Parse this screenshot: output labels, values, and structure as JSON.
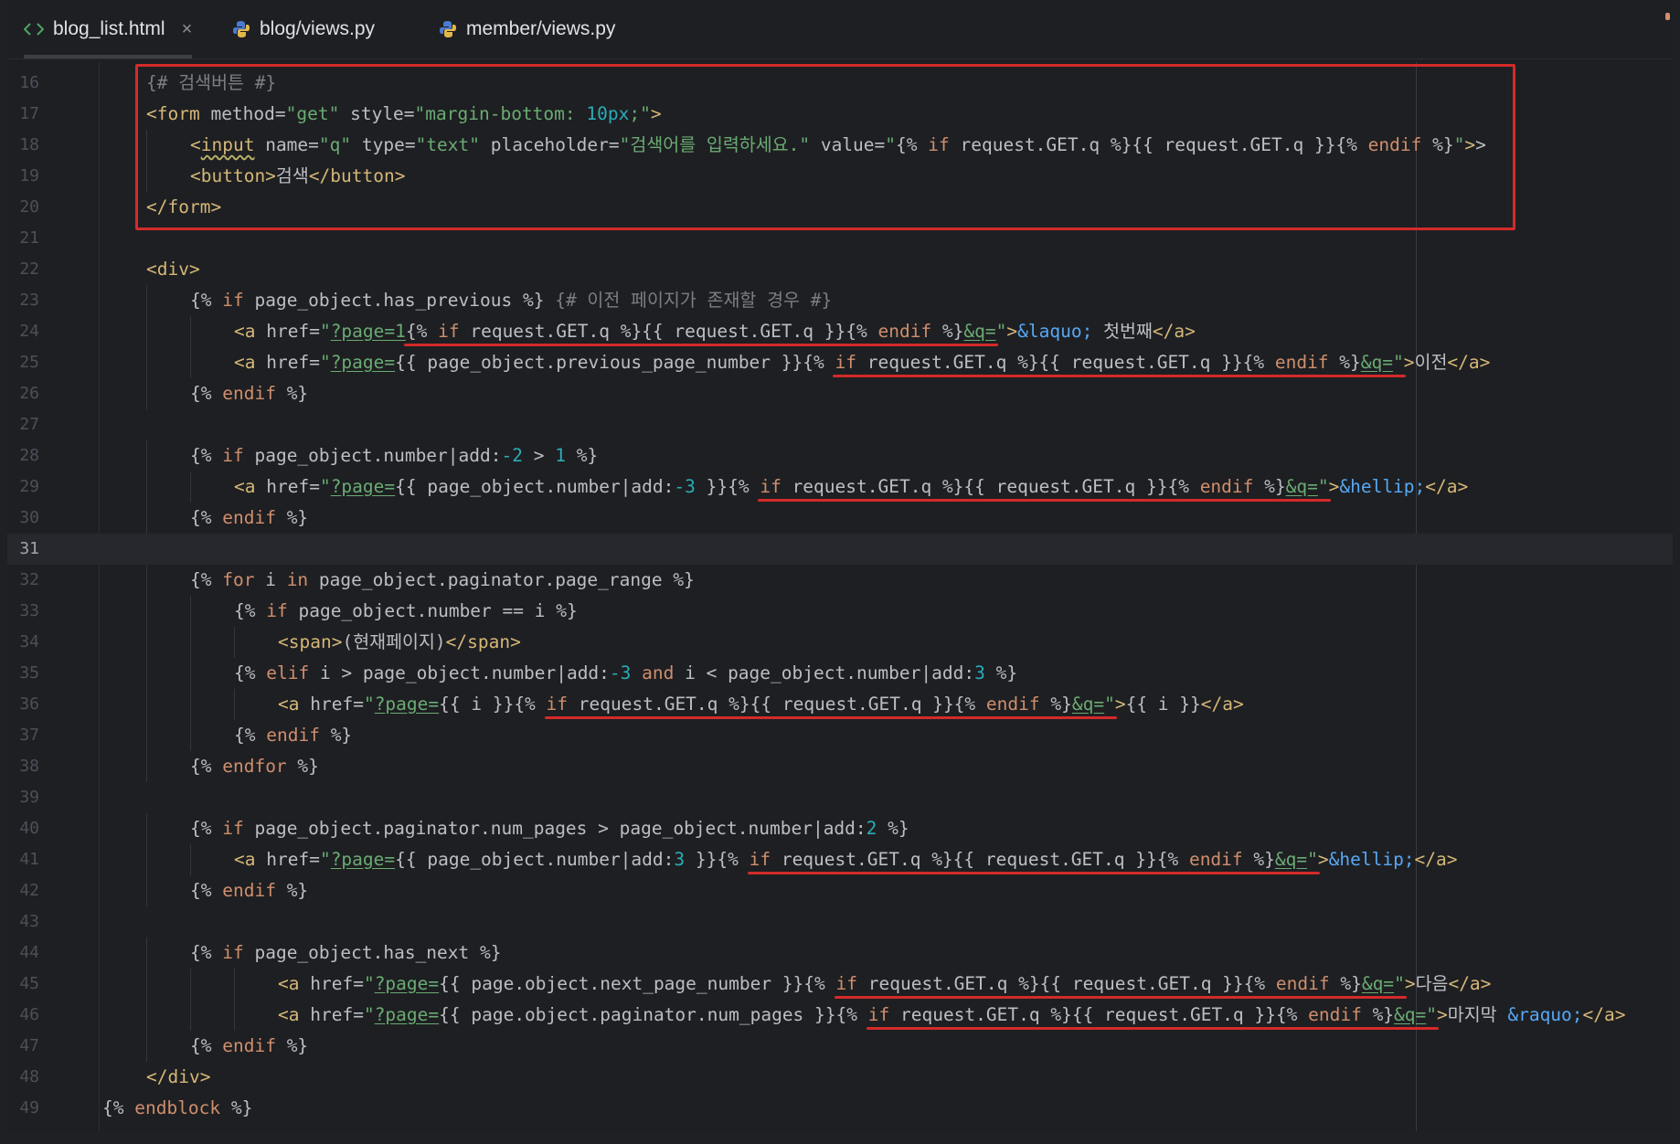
{
  "tabs": [
    {
      "label": "blog_list.html",
      "icon": "html-file-icon",
      "active": true,
      "close": "×"
    },
    {
      "label": "blog/views.py",
      "icon": "python-file-icon",
      "active": false
    },
    {
      "label": "member/views.py",
      "icon": "python-file-icon",
      "active": false
    }
  ],
  "current_line": 31,
  "colors": {
    "annotation_red": "#d42a2a",
    "keyword": "#cf8e6d",
    "string": "#6aab73",
    "tag": "#d5b778",
    "number": "#2aacb8",
    "entity": "#56a8f5"
  },
  "lines": [
    {
      "n": 16,
      "indent": 1,
      "tokens": [
        [
          "cm",
          "{# 검색버튼 #}"
        ]
      ]
    },
    {
      "n": 17,
      "indent": 1,
      "tokens": [
        [
          "tag",
          "<form "
        ],
        [
          "attr",
          "method="
        ],
        [
          "str",
          "\"get\" "
        ],
        [
          "attr",
          "style="
        ],
        [
          "str",
          "\"margin-bottom: "
        ],
        [
          "num",
          "10px"
        ],
        [
          "str",
          ";\""
        ],
        [
          "tag",
          ">"
        ]
      ]
    },
    {
      "n": 18,
      "indent": 2,
      "tokens": [
        [
          "tag",
          "<"
        ],
        [
          "tagsq",
          "input"
        ],
        [
          "tag",
          " "
        ],
        [
          "attr",
          "name="
        ],
        [
          "str",
          "\"q\" "
        ],
        [
          "attr",
          "type="
        ],
        [
          "str",
          "\"text\" "
        ],
        [
          "attr",
          "placeholder="
        ],
        [
          "str",
          "\"검색어를 입력하세요.\" "
        ],
        [
          "attr",
          "value="
        ],
        [
          "str",
          "\""
        ],
        [
          "tpl",
          "{% "
        ],
        [
          "kw",
          "if "
        ],
        [
          "tpl",
          "request.GET.q %}{{ request.GET.q }}{% "
        ],
        [
          "kw",
          "endif "
        ],
        [
          "tpl",
          "%}"
        ],
        [
          "str",
          "\""
        ],
        [
          "tag",
          ">"
        ],
        [
          "txt",
          ">"
        ]
      ]
    },
    {
      "n": 19,
      "indent": 2,
      "tokens": [
        [
          "tag",
          "<button>"
        ],
        [
          "txt",
          "검색"
        ],
        [
          "tag",
          "</button>"
        ]
      ]
    },
    {
      "n": 20,
      "indent": 1,
      "tokens": [
        [
          "tag",
          "</form>"
        ]
      ]
    },
    {
      "n": 21,
      "indent": 0,
      "tokens": []
    },
    {
      "n": 22,
      "indent": 1,
      "tokens": [
        [
          "tag",
          "<div>"
        ]
      ]
    },
    {
      "n": 23,
      "indent": 2,
      "tokens": [
        [
          "tpl",
          "{% "
        ],
        [
          "kw",
          "if "
        ],
        [
          "tpl",
          "page_object.has_previous %} "
        ],
        [
          "cm",
          "{# 이전 페이지가 존재할 경우 #}"
        ]
      ]
    },
    {
      "n": 24,
      "indent": 3,
      "tokens": [
        [
          "tag",
          "<a "
        ],
        [
          "attr",
          "href="
        ],
        [
          "str",
          "\""
        ],
        [
          "strul",
          "?page=1"
        ],
        [
          "tpl",
          "{% "
        ],
        [
          "kw",
          "if "
        ],
        [
          "tpl",
          "request.GET.q %}{{ request.GET.q }}{% "
        ],
        [
          "kw",
          "endif "
        ],
        [
          "tpl",
          "%}"
        ],
        [
          "strul",
          "&q="
        ],
        [
          "str",
          "\""
        ],
        [
          "tag",
          ">"
        ],
        [
          "ent",
          "&laquo;"
        ],
        [
          "txt",
          " 첫번째"
        ],
        [
          "tag",
          "</a>"
        ]
      ]
    },
    {
      "n": 25,
      "indent": 3,
      "tokens": [
        [
          "tag",
          "<a "
        ],
        [
          "attr",
          "href="
        ],
        [
          "str",
          "\""
        ],
        [
          "strul",
          "?page="
        ],
        [
          "tpl",
          "{{ page_object.previous_page_number }}{% "
        ],
        [
          "kw",
          "if "
        ],
        [
          "tpl",
          "request.GET.q %}{{ request.GET.q }}{% "
        ],
        [
          "kw",
          "endif "
        ],
        [
          "tpl",
          "%}"
        ],
        [
          "strul",
          "&q="
        ],
        [
          "str",
          "\""
        ],
        [
          "tag",
          ">"
        ],
        [
          "txt",
          "이전"
        ],
        [
          "tag",
          "</a>"
        ]
      ]
    },
    {
      "n": 26,
      "indent": 2,
      "tokens": [
        [
          "tpl",
          "{% "
        ],
        [
          "kw",
          "endif "
        ],
        [
          "tpl",
          "%}"
        ]
      ]
    },
    {
      "n": 27,
      "indent": 0,
      "tokens": []
    },
    {
      "n": 28,
      "indent": 2,
      "tokens": [
        [
          "tpl",
          "{% "
        ],
        [
          "kw",
          "if "
        ],
        [
          "tpl",
          "page_object.number|add:"
        ],
        [
          "num",
          "-2"
        ],
        [
          "tpl",
          " > "
        ],
        [
          "num",
          "1"
        ],
        [
          "tpl",
          " %}"
        ]
      ]
    },
    {
      "n": 29,
      "indent": 3,
      "tokens": [
        [
          "tag",
          "<a "
        ],
        [
          "attr",
          "href="
        ],
        [
          "str",
          "\""
        ],
        [
          "strul",
          "?page="
        ],
        [
          "tpl",
          "{{ page_object.number|add:"
        ],
        [
          "num",
          "-3"
        ],
        [
          "tpl",
          " }}{% "
        ],
        [
          "kw",
          "if "
        ],
        [
          "tpl",
          "request.GET.q %}{{ request.GET.q }}{% "
        ],
        [
          "kw",
          "endif "
        ],
        [
          "tpl",
          "%}"
        ],
        [
          "strul",
          "&q="
        ],
        [
          "str",
          "\""
        ],
        [
          "tag",
          ">"
        ],
        [
          "ent",
          "&hellip;"
        ],
        [
          "tag",
          "</a>"
        ]
      ]
    },
    {
      "n": 30,
      "indent": 2,
      "tokens": [
        [
          "tpl",
          "{% "
        ],
        [
          "kw",
          "endif "
        ],
        [
          "tpl",
          "%}"
        ]
      ]
    },
    {
      "n": 31,
      "indent": 0,
      "tokens": []
    },
    {
      "n": 32,
      "indent": 2,
      "tokens": [
        [
          "tpl",
          "{% "
        ],
        [
          "kw",
          "for "
        ],
        [
          "tpl",
          "i "
        ],
        [
          "kw",
          "in "
        ],
        [
          "tpl",
          "page_object.paginator.page_range %}"
        ]
      ]
    },
    {
      "n": 33,
      "indent": 3,
      "tokens": [
        [
          "tpl",
          "{% "
        ],
        [
          "kw",
          "if "
        ],
        [
          "tpl",
          "page_object.number == i %}"
        ]
      ]
    },
    {
      "n": 34,
      "indent": 4,
      "tokens": [
        [
          "tag",
          "<span>"
        ],
        [
          "txt",
          "(현재페이지)"
        ],
        [
          "tag",
          "</span>"
        ]
      ]
    },
    {
      "n": 35,
      "indent": 3,
      "tokens": [
        [
          "tpl",
          "{% "
        ],
        [
          "kw",
          "elif "
        ],
        [
          "tpl",
          "i > page_object.number|add:"
        ],
        [
          "num",
          "-3"
        ],
        [
          "kw",
          " and "
        ],
        [
          "tpl",
          "i < page_object.number|add:"
        ],
        [
          "num",
          "3"
        ],
        [
          "tpl",
          " %}"
        ]
      ]
    },
    {
      "n": 36,
      "indent": 4,
      "tokens": [
        [
          "tag",
          "<a "
        ],
        [
          "attr",
          "href="
        ],
        [
          "str",
          "\""
        ],
        [
          "strul",
          "?page="
        ],
        [
          "tpl",
          "{{ i }}{% "
        ],
        [
          "kw",
          "if "
        ],
        [
          "tpl",
          "request.GET.q %}{{ request.GET.q }}{% "
        ],
        [
          "kw",
          "endif "
        ],
        [
          "tpl",
          "%}"
        ],
        [
          "strul",
          "&q="
        ],
        [
          "str",
          "\""
        ],
        [
          "tag",
          ">"
        ],
        [
          "tpl",
          "{{ i }}"
        ],
        [
          "tag",
          "</a>"
        ]
      ]
    },
    {
      "n": 37,
      "indent": 3,
      "tokens": [
        [
          "tpl",
          "{% "
        ],
        [
          "kw",
          "endif "
        ],
        [
          "tpl",
          "%}"
        ]
      ]
    },
    {
      "n": 38,
      "indent": 2,
      "tokens": [
        [
          "tpl",
          "{% "
        ],
        [
          "kw",
          "endfor "
        ],
        [
          "tpl",
          "%}"
        ]
      ]
    },
    {
      "n": 39,
      "indent": 0,
      "tokens": []
    },
    {
      "n": 40,
      "indent": 2,
      "tokens": [
        [
          "tpl",
          "{% "
        ],
        [
          "kw",
          "if "
        ],
        [
          "tpl",
          "page_object.paginator.num_pages > page_object.number|add:"
        ],
        [
          "num",
          "2"
        ],
        [
          "tpl",
          " %}"
        ]
      ]
    },
    {
      "n": 41,
      "indent": 3,
      "tokens": [
        [
          "tag",
          "<a "
        ],
        [
          "attr",
          "href="
        ],
        [
          "str",
          "\""
        ],
        [
          "strul",
          "?page="
        ],
        [
          "tpl",
          "{{ page_object.number|add:"
        ],
        [
          "num",
          "3"
        ],
        [
          "tpl",
          " }}{% "
        ],
        [
          "kw",
          "if "
        ],
        [
          "tpl",
          "request.GET.q %}{{ request.GET.q }}{% "
        ],
        [
          "kw",
          "endif "
        ],
        [
          "tpl",
          "%}"
        ],
        [
          "strul",
          "&q="
        ],
        [
          "str",
          "\""
        ],
        [
          "tag",
          ">"
        ],
        [
          "ent",
          "&hellip;"
        ],
        [
          "tag",
          "</a>"
        ]
      ]
    },
    {
      "n": 42,
      "indent": 2,
      "tokens": [
        [
          "tpl",
          "{% "
        ],
        [
          "kw",
          "endif "
        ],
        [
          "tpl",
          "%}"
        ]
      ]
    },
    {
      "n": 43,
      "indent": 0,
      "tokens": []
    },
    {
      "n": 44,
      "indent": 2,
      "tokens": [
        [
          "tpl",
          "{% "
        ],
        [
          "kw",
          "if "
        ],
        [
          "tpl",
          "page_object.has_next %}"
        ]
      ]
    },
    {
      "n": 45,
      "indent": 4,
      "tokens": [
        [
          "tag",
          "<a "
        ],
        [
          "attr",
          "href="
        ],
        [
          "str",
          "\""
        ],
        [
          "strul",
          "?page="
        ],
        [
          "tpl",
          "{{ page.object.next_page_number }}{% "
        ],
        [
          "kw",
          "if "
        ],
        [
          "tpl",
          "request.GET.q %}{{ request.GET.q }}{% "
        ],
        [
          "kw",
          "endif "
        ],
        [
          "tpl",
          "%}"
        ],
        [
          "strul",
          "&q="
        ],
        [
          "str",
          "\""
        ],
        [
          "tag",
          ">"
        ],
        [
          "txt",
          "다음"
        ],
        [
          "tag",
          "</a>"
        ]
      ]
    },
    {
      "n": 46,
      "indent": 4,
      "tokens": [
        [
          "tag",
          "<a "
        ],
        [
          "attr",
          "href="
        ],
        [
          "str",
          "\""
        ],
        [
          "strul",
          "?page="
        ],
        [
          "tpl",
          "{{ page.object.paginator.num_pages }}{% "
        ],
        [
          "kw",
          "if "
        ],
        [
          "tpl",
          "request.GET.q %}{{ request.GET.q }}{% "
        ],
        [
          "kw",
          "endif "
        ],
        [
          "tpl",
          "%}"
        ],
        [
          "strul",
          "&q="
        ],
        [
          "str",
          "\""
        ],
        [
          "tag",
          ">"
        ],
        [
          "txt",
          "마지막 "
        ],
        [
          "ent",
          "&raquo;"
        ],
        [
          "tag",
          "</a>"
        ]
      ]
    },
    {
      "n": 47,
      "indent": 2,
      "tokens": [
        [
          "tpl",
          "{% "
        ],
        [
          "kw",
          "endif "
        ],
        [
          "tpl",
          "%}"
        ]
      ]
    },
    {
      "n": 48,
      "indent": 1,
      "tokens": [
        [
          "tag",
          "</div>"
        ]
      ]
    },
    {
      "n": 49,
      "indent": 0,
      "tokens": [
        [
          "tpl",
          "{% "
        ],
        [
          "kw",
          "endblock "
        ],
        [
          "tpl",
          "%}"
        ]
      ]
    }
  ]
}
